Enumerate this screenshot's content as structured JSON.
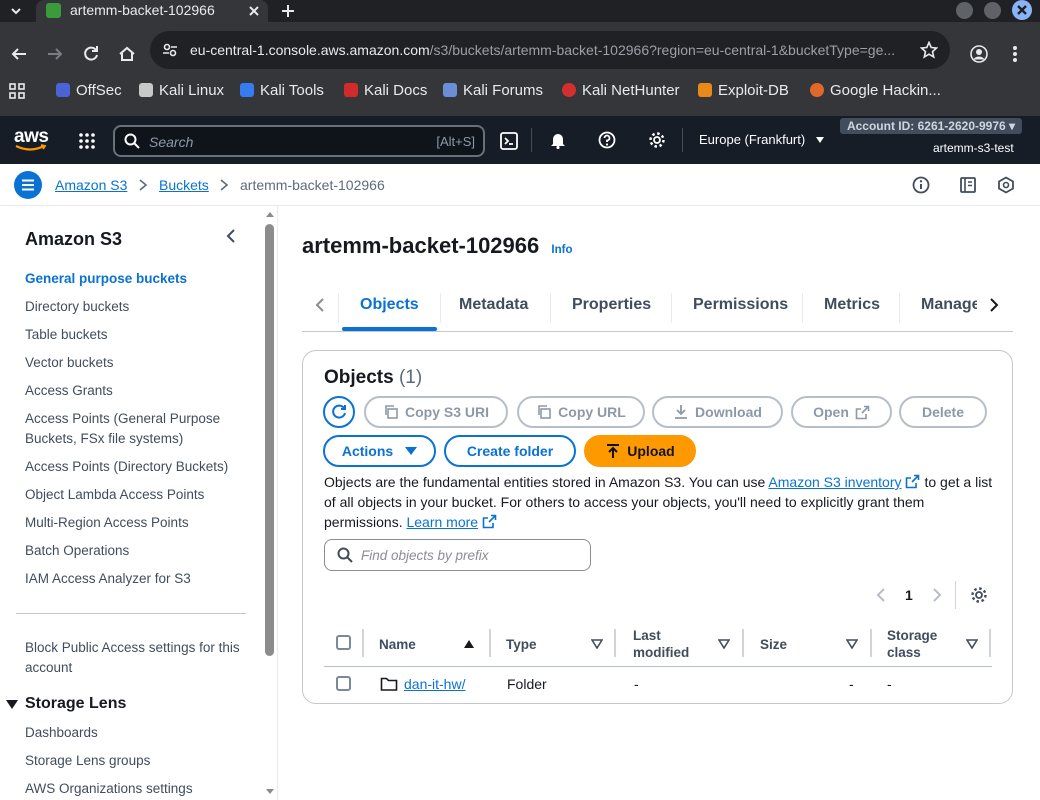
{
  "browser": {
    "tab_title": "artemm-backet-102966",
    "url_host": "eu-central-1.console.aws.amazon.com",
    "url_path": "/s3/buckets/artemm-backet-102966?region=eu-central-1&bucketType=ge...",
    "bookmarks": [
      "OffSec",
      "Kali Linux",
      "Kali Tools",
      "Kali Docs",
      "Kali Forums",
      "Kali NetHunter",
      "Exploit-DB",
      "Google Hackin..."
    ]
  },
  "aws_header": {
    "logo": "aws",
    "search_placeholder": "Search",
    "search_shortcut": "[Alt+S]",
    "region": "Europe (Frankfurt)",
    "account_id": "Account ID: 6261-2620-9976",
    "user": "artemm-s3-test"
  },
  "breadcrumb": {
    "items": [
      "Amazon S3",
      "Buckets",
      "artemm-backet-102966"
    ]
  },
  "sidenav": {
    "title": "Amazon S3",
    "items": [
      "General purpose buckets",
      "Directory buckets",
      "Table buckets",
      "Vector buckets",
      "Access Grants",
      "Access Points (General Purpose Buckets, FSx file systems)",
      "Access Points (Directory Buckets)",
      "Object Lambda Access Points",
      "Multi-Region Access Points",
      "Batch Operations",
      "IAM Access Analyzer for S3"
    ],
    "block_public": "Block Public Access settings for this account",
    "storage_lens_title": "Storage Lens",
    "storage_lens_items": [
      "Dashboards",
      "Storage Lens groups",
      "AWS Organizations settings"
    ]
  },
  "main": {
    "bucket_name": "artemm-backet-102966",
    "info_label": "Info",
    "tabs": [
      "Objects",
      "Metadata",
      "Properties",
      "Permissions",
      "Metrics",
      "Manage"
    ],
    "objects_title": "Objects",
    "objects_count": "(1)",
    "buttons": {
      "copy_s3_uri": "Copy S3 URI",
      "copy_url": "Copy URL",
      "download": "Download",
      "open": "Open",
      "delete": "Delete",
      "actions": "Actions",
      "create_folder": "Create folder",
      "upload": "Upload"
    },
    "description_1": "Objects are the fundamental entities stored in Amazon S3. You can use",
    "inventory_link": "Amazon S3 inventory",
    "description_2": "to get a list of all objects in your bucket. For others to access your objects, you'll need to explicitly grant them permissions.",
    "learn_more": "Learn more",
    "filter_placeholder": "Find objects by prefix",
    "page_number": "1",
    "columns": [
      "Name",
      "Type",
      "Last modified",
      "Size",
      "Storage class"
    ],
    "rows": [
      {
        "name": "dan-it-hw/",
        "type": "Folder",
        "last_modified": "-",
        "size": "-",
        "storage_class": "-"
      }
    ]
  }
}
